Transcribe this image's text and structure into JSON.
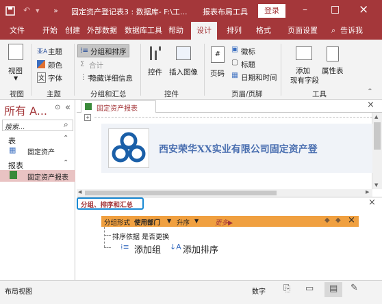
{
  "titlebar": {
    "save_icon": "save-icon",
    "undo_icon": "undo-icon",
    "more": "»",
    "title": "固定资产登记表3 : 数据库- F:\\工...",
    "context_tab": "报表布局工具",
    "login": "登录",
    "minimize": "–",
    "restore": "□",
    "close": "×"
  },
  "tabs": [
    "文件",
    "开始",
    "创建",
    "外部数据",
    "数据库工具",
    "帮助",
    "设计",
    "排列",
    "格式",
    "页面设置"
  ],
  "active_tab": "设计",
  "tell_me": "告诉我",
  "ribbon": {
    "view": {
      "label": "视图",
      "group": "视图"
    },
    "theme": {
      "themes": "主题",
      "colors": "颜色",
      "fonts": "字体",
      "group": "主题"
    },
    "grouping": {
      "group_sort": "分组和排序",
      "totals": "合计",
      "hide_details": "隐藏详细信息",
      "group": "分组和汇总"
    },
    "controls": {
      "controls": "控件",
      "insert_image": "插入图像",
      "group": "控件"
    },
    "header_footer": {
      "page_number": "页码",
      "logo": "徽标",
      "title": "标题",
      "datetime": "日期和时间",
      "group": "页眉/页脚"
    },
    "tools": {
      "add_fields": "添加\n现有字段",
      "property_sheet": "属性表",
      "group": "工具"
    }
  },
  "nav": {
    "title": "所有 A...",
    "search_placeholder": "搜索...",
    "sections": [
      {
        "name": "表",
        "items": [
          "固定资产"
        ]
      },
      {
        "name": "报表",
        "items": [
          "固定资产报表"
        ]
      }
    ]
  },
  "document": {
    "tab_label": "固定资产报表",
    "report_header_text": "西安荣华XX实业有限公司固定资产登"
  },
  "group_pane": {
    "title": "分组、排序和汇总",
    "group_row": {
      "prefix": "分组形式",
      "field": "使用部门",
      "order": "升序",
      "more": "更多▶"
    },
    "sort_row": "排序依据 是否更换",
    "add_group": "添加组",
    "add_sort": "添加排序"
  },
  "status": {
    "left": "布局视图",
    "num": "数字"
  },
  "colors": {
    "accent": "#a4373a",
    "highlight": "#f0a040"
  }
}
